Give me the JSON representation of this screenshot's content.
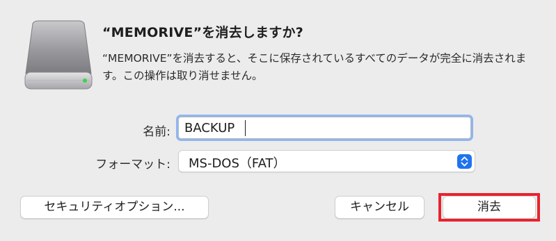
{
  "dialog": {
    "title": "“MEMORIVE”を消去しますか?",
    "message": "“MEMORIVE”を消去すると、そこに保存されているすべてのデータが完全に消去されます。この操作は取り消せません。",
    "icon": "external-drive-icon"
  },
  "form": {
    "name_label": "名前:",
    "name_value": "BACKUP",
    "format_label": "フォーマット:",
    "format_value": "MS-DOS（FAT）",
    "stepper_icon": "chevron-up-down-icon"
  },
  "buttons": {
    "security_options": "セキュリティオプション...",
    "cancel": "キャンセル",
    "erase": "消去"
  },
  "colors": {
    "accent": "#1f73f0",
    "focus_ring": "#8fb6f0",
    "highlight": "#e8232f"
  }
}
